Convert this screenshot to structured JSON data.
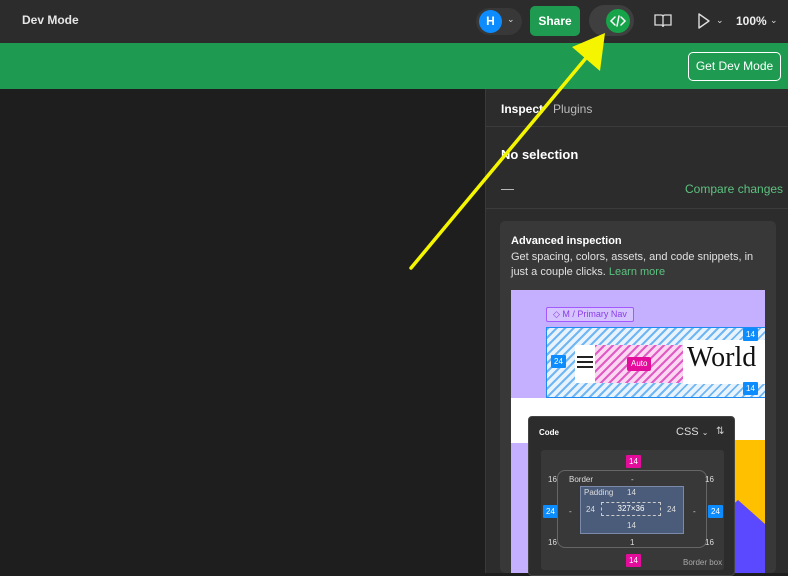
{
  "topbar": {
    "title": "Dev Mode",
    "avatar_initial": "H",
    "share_label": "Share",
    "zoom": "100%"
  },
  "banner": {
    "get_dev_mode_label": "Get Dev Mode"
  },
  "panel": {
    "tabs": [
      {
        "label": "Inspect"
      },
      {
        "label": "Plugins"
      }
    ],
    "selection": "No selection",
    "dash": "—",
    "compare_changes": "Compare changes",
    "card": {
      "title": "Advanced inspection",
      "body": "Get spacing, colors, assets, and code snippets, in just a couple clicks.",
      "link": "Learn more"
    }
  },
  "illustration": {
    "component_tag": "◇ M / Primary Nav",
    "auto_label": "Auto",
    "world_text": "World",
    "badge_14": "14",
    "badge_24": "24"
  },
  "code_panel": {
    "title": "Code",
    "language": "CSS",
    "border_label": "Border",
    "border_value": "-",
    "padding_label": "Padding",
    "padding_top": "14",
    "padding_bottom": "14",
    "padding_left": "24",
    "padding_right": "24",
    "size": "327×36",
    "margin_top": "14",
    "margin_bottom": "14",
    "margin_left": "24",
    "margin_right": "24",
    "corner_radius": "16",
    "border_bottom": "1",
    "side_dash": "-",
    "border_box_label": "Border box"
  },
  "colors": {
    "accent_green": "#1e9a51",
    "blue": "#0d8cff",
    "pink": "#e40c9a",
    "arrow_yellow": "#f5f500"
  }
}
